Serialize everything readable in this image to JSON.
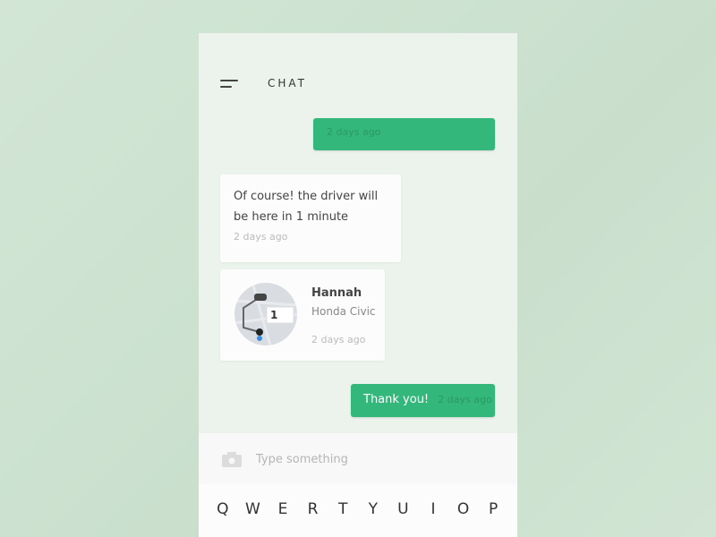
{
  "header": {
    "title": "CHAT",
    "menu_icon": "hamburger-icon"
  },
  "messages": [
    {
      "type": "sent",
      "text": "",
      "time": "2 days ago"
    },
    {
      "type": "received",
      "text": "Of course! the driver will be here in 1 minute",
      "time": "2 days ago"
    },
    {
      "type": "driver-card",
      "name": "Hannah",
      "car": "Honda Civic",
      "eta": "1",
      "time": "2 days ago"
    },
    {
      "type": "sent",
      "text": "Thank you!",
      "time": "2 days ago"
    }
  ],
  "composer": {
    "placeholder": "Type something",
    "icon": "camera-icon"
  },
  "keyboard": {
    "row1": [
      "Q",
      "W",
      "E",
      "R",
      "T",
      "Y",
      "U",
      "I",
      "O",
      "P"
    ]
  },
  "colors": {
    "accent": "#34b77b",
    "background": "#ebf3ec"
  }
}
